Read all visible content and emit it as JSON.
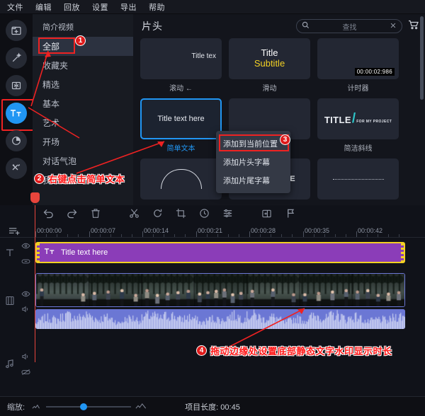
{
  "menubar": {
    "items": [
      {
        "label": "文件"
      },
      {
        "label": "编辑"
      },
      {
        "label": "回放"
      },
      {
        "label": "设置"
      },
      {
        "label": "导出"
      },
      {
        "label": "帮助"
      }
    ]
  },
  "rail": {
    "items": [
      {
        "icon": "add-media-icon",
        "name": "media-button"
      },
      {
        "icon": "magic-wand-icon",
        "name": "effects-button"
      },
      {
        "icon": "transition-icon",
        "name": "transitions-button"
      },
      {
        "icon": "text-tt-icon",
        "name": "titles-button",
        "active": true
      },
      {
        "icon": "filter-pie-icon",
        "name": "filters-button"
      },
      {
        "icon": "tools-icon",
        "name": "tools-button"
      }
    ],
    "accent": "#2196f3"
  },
  "categories": {
    "header": "简介视频",
    "items": [
      {
        "label": "全部",
        "selected": true
      },
      {
        "label": "收藏夹"
      },
      {
        "label": "精选"
      },
      {
        "label": "基本"
      },
      {
        "label": "艺术"
      },
      {
        "label": "开场"
      },
      {
        "label": "对话气泡"
      },
      {
        "label": "我的片头"
      }
    ]
  },
  "content": {
    "title": "片头",
    "search": {
      "placeholder": "查找",
      "value": ""
    },
    "cart_label": "购物车",
    "items": [
      {
        "label": "滚动 ←",
        "preview": "Title tex",
        "kind": "scroll"
      },
      {
        "label": "滑动",
        "preview_title": "Title",
        "preview_sub": "Subtitle",
        "kind": "slide"
      },
      {
        "label": "计时器",
        "preview": "00:00:02:986",
        "kind": "timer"
      },
      {
        "label": "简单文本",
        "preview": "Title text here",
        "kind": "simple",
        "selected": true
      },
      {
        "label": "",
        "preview": "",
        "kind": "blank"
      },
      {
        "label": "简洁斜线",
        "preview_title": "TITLE",
        "preview_sub": "FOR MY PROJECT",
        "kind": "slash"
      },
      {
        "label": "",
        "preview": "",
        "kind": "arc"
      },
      {
        "label": "",
        "preview": "TITLE HERE",
        "kind": "here"
      },
      {
        "label": "",
        "preview": "",
        "kind": "dots"
      }
    ]
  },
  "context_menu": {
    "items": [
      {
        "label": "添加到当前位置",
        "highlighted": true
      },
      {
        "label": "添加片头字幕"
      },
      {
        "label": "添加片尾字幕"
      }
    ]
  },
  "timeline": {
    "tools": [
      {
        "name": "undo-icon"
      },
      {
        "name": "redo-icon"
      },
      {
        "name": "delete-icon"
      },
      {
        "name": "split-scissors-icon"
      },
      {
        "name": "rotate-icon"
      },
      {
        "name": "crop-icon"
      },
      {
        "name": "speed-clock-icon"
      },
      {
        "name": "adjust-sliders-icon"
      },
      {
        "name": "pip-icon"
      },
      {
        "name": "marker-flag-icon"
      }
    ],
    "ruler": {
      "ticks": [
        "00:00:00",
        "00:00:07",
        "00:00:14",
        "00:00:21",
        "00:00:28",
        "00:00:35",
        "00:00:42"
      ],
      "playhead": "00:00:00"
    },
    "tracks": [
      {
        "type": "text",
        "clip_label": "Title text here",
        "clip_color": "#8b3db8",
        "selected": true
      },
      {
        "type": "video",
        "clip_color": "#6b77d4"
      },
      {
        "type": "music",
        "clip_color": "#6b77d4"
      }
    ],
    "zoom_label": "缩放:",
    "project_length": "项目长度: 00:45"
  },
  "annotations": [
    {
      "num": "1",
      "text": ""
    },
    {
      "num": "2",
      "text": "右键点击简单文本"
    },
    {
      "num": "3",
      "text": ""
    },
    {
      "num": "4",
      "text": "拖动边缘处设置底部静态文字水印显示时长"
    }
  ]
}
